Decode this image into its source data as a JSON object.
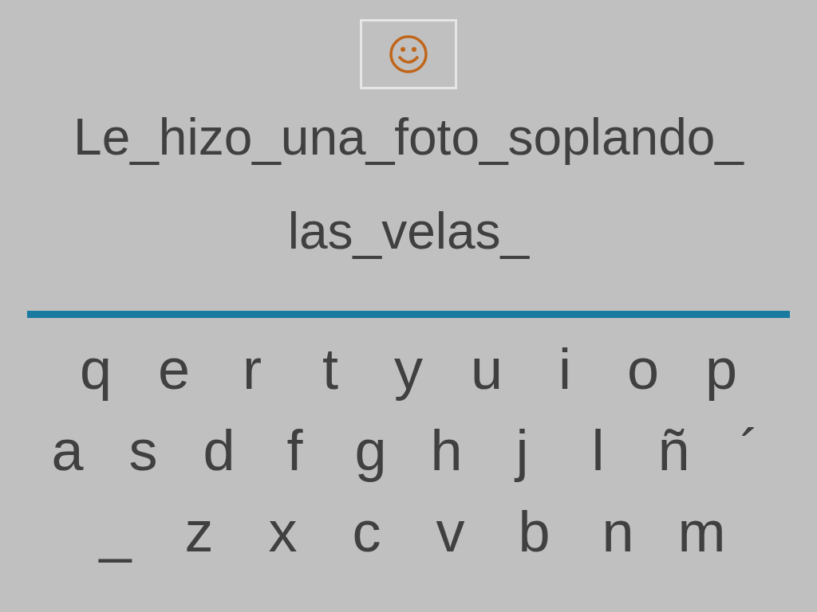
{
  "sentence_lines": [
    "Le_hizo_una_foto_soplando_",
    "las_velas_"
  ],
  "keyboard_rows": [
    [
      "q",
      "e",
      "r",
      "t",
      "y",
      "u",
      "i",
      "o",
      "p"
    ],
    [
      "a",
      "s",
      "d",
      "f",
      "g",
      "h",
      "j",
      "l",
      "ñ",
      "´"
    ],
    [
      "_",
      "z",
      "x",
      "c",
      "v",
      "b",
      "n",
      "m"
    ]
  ]
}
